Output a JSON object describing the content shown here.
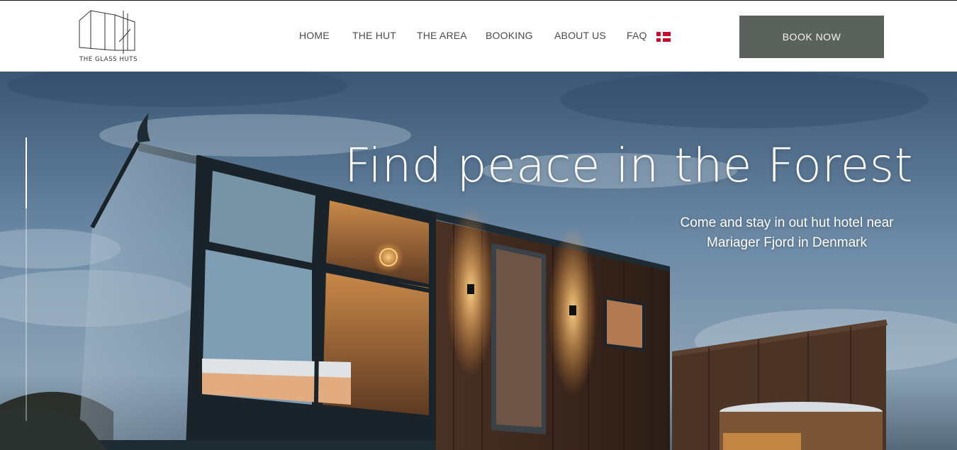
{
  "brand": {
    "name": "THE GLASS HUTS"
  },
  "nav": {
    "items": [
      {
        "label": "HOME"
      },
      {
        "label": "THE HUT"
      },
      {
        "label": "THE AREA"
      },
      {
        "label": "BOOKING"
      },
      {
        "label": "ABOUT US"
      },
      {
        "label": "FAQ"
      }
    ],
    "language_icon": "danish-flag-icon"
  },
  "cta": {
    "label": "BOOK NOW",
    "color": "#5b625e"
  },
  "hero": {
    "title": "Find peace in the Forest",
    "subtitle_line1": "Come and stay in out hut hotel near",
    "subtitle_line2": "Mariager Fjord in Denmark"
  },
  "colors": {
    "header_bg": "#ffffff",
    "nav_text": "#4a4a4a",
    "hero_text": "#ffffff"
  }
}
